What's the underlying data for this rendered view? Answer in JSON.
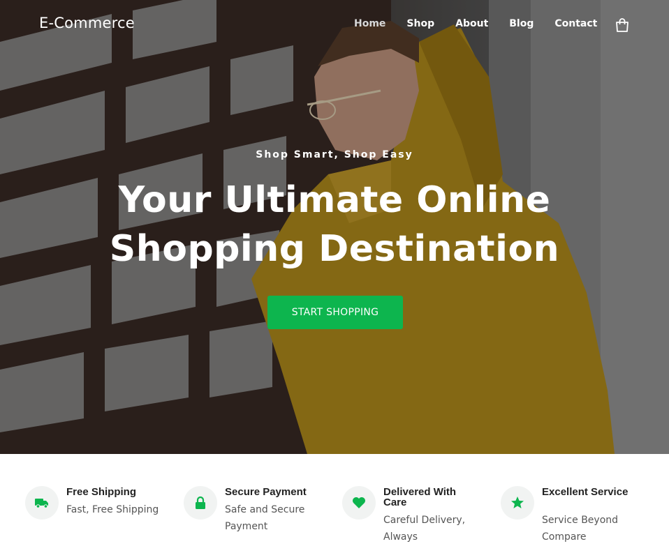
{
  "brand": "E-Commerce",
  "nav": {
    "items": [
      {
        "label": "Home",
        "active": true
      },
      {
        "label": "Shop",
        "active": false
      },
      {
        "label": "About",
        "active": false
      },
      {
        "label": "Blog",
        "active": false
      },
      {
        "label": "Contact",
        "active": false
      }
    ],
    "cart_icon": "shopping-bag-icon"
  },
  "hero": {
    "tagline": "Shop Smart, Shop Easy",
    "headline_line1": "Your Ultimate Online",
    "headline_line2": "Shopping Destination",
    "cta_label": "START SHOPPING"
  },
  "features": [
    {
      "icon": "truck-icon",
      "title": "Free Shipping",
      "description": "Fast, Free Shipping"
    },
    {
      "icon": "lock-icon",
      "title": "Secure Payment",
      "description": "Safe and Secure Payment"
    },
    {
      "icon": "heart-icon",
      "title": "Delivered With Care",
      "description": "Careful Delivery, Always"
    },
    {
      "icon": "star-icon",
      "title": "Excellent Service",
      "description": "Service Beyond Compare"
    }
  ],
  "colors": {
    "accent": "#0db54e",
    "icon_bg": "#f1f3f2",
    "hoodie": "#b8901c",
    "text_dark": "#222222",
    "text_muted": "#555555"
  }
}
